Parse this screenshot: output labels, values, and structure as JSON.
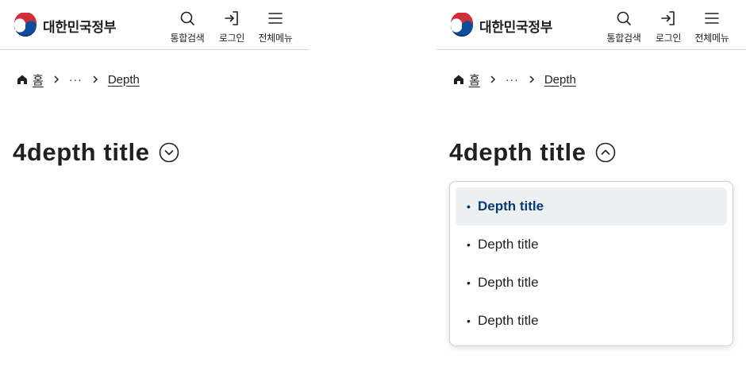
{
  "header": {
    "logo_text": "대한민국정부",
    "search_label": "통합검색",
    "login_label": "로그인",
    "menu_label": "전체메뉴"
  },
  "breadcrumb": {
    "home": "홈",
    "ellipsis": "···",
    "current": "Depth"
  },
  "title": "4depth title",
  "dropdown": {
    "items": [
      {
        "label": "Depth title",
        "active": true
      },
      {
        "label": "Depth title",
        "active": false
      },
      {
        "label": "Depth title",
        "active": false
      },
      {
        "label": "Depth title",
        "active": false
      }
    ]
  },
  "colors": {
    "text": "#1e2124",
    "active_text": "#063a74",
    "active_bg": "#edf0f3",
    "border": "#cdd1d5"
  }
}
